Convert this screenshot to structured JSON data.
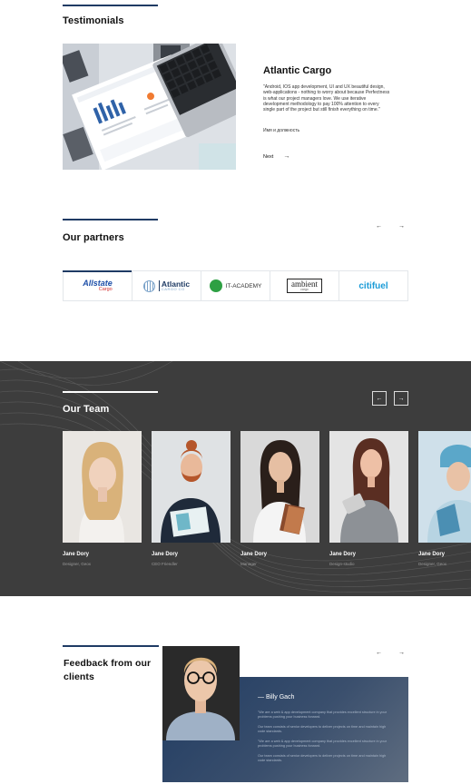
{
  "testimonials": {
    "heading": "Testimonials",
    "title": "Atlantic Cargo",
    "quote": "\"Android, IOS app development, UI and UX beautiful design, web-applications - nothing to worry about because Perfectness is what our project managers love. We use iterative development methodology to pay 100% attention to every single part of the project but still finish everything on time.\"",
    "signature": "Имя и должность",
    "next_label": "Next",
    "next_arrow": "→"
  },
  "partners": {
    "heading": "Our partners",
    "prev_arrow": "←",
    "next_arrow": "→",
    "logos": [
      {
        "name": "Allstate",
        "sub": "Cargo"
      },
      {
        "name": "Atlantic",
        "sub": "CARGO CO"
      },
      {
        "name": "IT-ACADEMY"
      },
      {
        "name": "ambient",
        "sub": "cargo"
      },
      {
        "name": "citifuel"
      }
    ]
  },
  "team": {
    "heading": "Our Team",
    "prev_arrow": "←",
    "next_arrow": "→",
    "members": [
      {
        "name": "Jane Dory",
        "role": "Designer, Geox"
      },
      {
        "name": "Jane Dory",
        "role": "CEO Friendler"
      },
      {
        "name": "Jane Dory",
        "role": "Manager"
      },
      {
        "name": "Jane Dory",
        "role": "Design-studio"
      },
      {
        "name": "Jane Dory",
        "role": "Designer, Geox"
      }
    ]
  },
  "feedback": {
    "heading": "Feedback from our clients",
    "prev_arrow": "←",
    "next_arrow": "→",
    "client_name": "— Billy Gach",
    "paragraphs": [
      "\"We are a web & app development company that provides excellent structure in your problems pushing your business forward.",
      "Our team consists of senior developers to deliver projects on time and maintain high code standards.",
      "\"We are a web & app development company that provides excellent structure in your problems pushing your business forward.",
      "Our team consists of senior developers to deliver projects on time and maintain high code standards."
    ]
  },
  "colors": {
    "accent": "#1f3b64",
    "team_background": "#3d3d3d",
    "allstate_blue": "#1e4fa8",
    "allstate_red": "#d32f2f",
    "itacademy_green": "#2ea043",
    "citifuel_blue": "#1a9bd7"
  }
}
